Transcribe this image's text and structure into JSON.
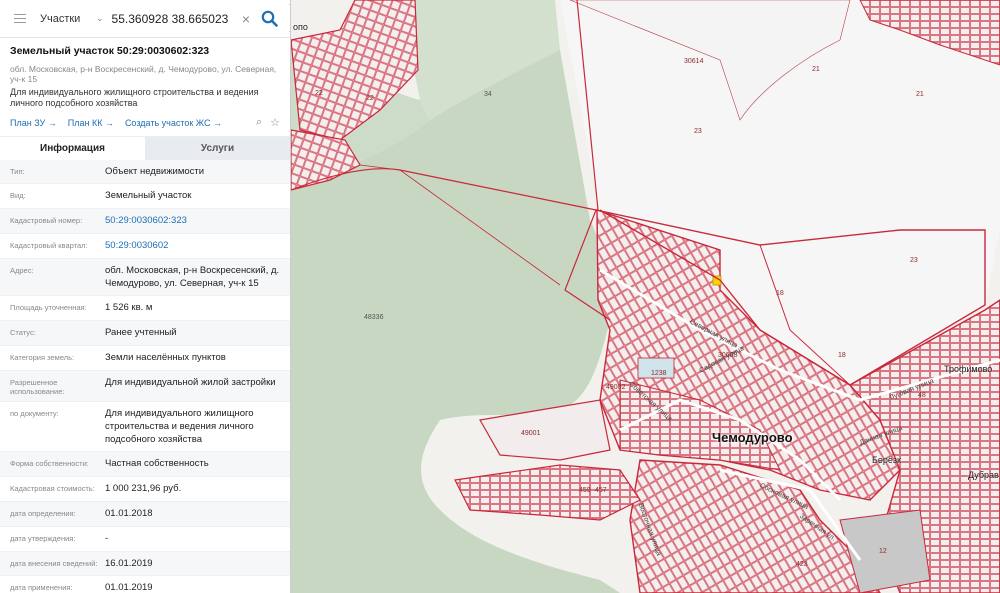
{
  "search": {
    "type": "Участки",
    "query": "55.360928 38.665023"
  },
  "parcel": {
    "title": "Земельный участок 50:29:0030602:323",
    "address": "обл. Московская, р-н Воскресенский, д. Чемодурово, ул. Северная, уч-к 15",
    "purpose": "Для индивидуального жилищного строительства и ведения личного подсобного хозяйства",
    "actions": [
      "План ЗУ →",
      "План КК →",
      "Создать участок ЖС →"
    ]
  },
  "tabs": {
    "info": "Информация",
    "services": "Услуги"
  },
  "info": [
    {
      "label": "Тип:",
      "value": "Объект недвижимости",
      "link": false
    },
    {
      "label": "Вид:",
      "value": "Земельный участок",
      "link": false
    },
    {
      "label": "Кадастровый номер:",
      "value": "50:29:0030602:323",
      "link": true
    },
    {
      "label": "Кадастровый квартал:",
      "value": "50:29:0030602",
      "link": true
    },
    {
      "label": "Адрес:",
      "value": "обл. Московская, р-н Воскресенский, д. Чемодурово, ул. Северная, уч-к 15",
      "link": false
    },
    {
      "label": "Площадь уточненная:",
      "value": "1 526 кв. м",
      "link": false
    },
    {
      "label": "Статус:",
      "value": "Ранее учтенный",
      "link": false
    },
    {
      "label": "Категория земель:",
      "value": "Земли населённых пунктов",
      "link": false
    },
    {
      "label": "Разрешенное использование:",
      "value": "Для индивидуальной жилой застройки",
      "link": false
    },
    {
      "label": "по документу:",
      "value": "Для индивидуального жилищного строительства и ведения личного подсобного хозяйства",
      "link": false
    },
    {
      "label": "Форма собственности:",
      "value": "Частная собственность",
      "link": false
    },
    {
      "label": "Кадастровая стоимость:",
      "value": "1 000 231,96 руб.",
      "link": false
    },
    {
      "label": "дата определения:",
      "value": "01.01.2018",
      "link": false
    },
    {
      "label": "дата утверждения:",
      "value": "-",
      "link": false
    },
    {
      "label": "дата внесения сведений:",
      "value": "16.01.2019",
      "link": false
    },
    {
      "label": "дата применения:",
      "value": "01.01.2019",
      "link": false
    }
  ],
  "map": {
    "village": "Чемодурово",
    "places": [
      "Трофимово",
      "Берёзк",
      "Дубрав",
      "опо"
    ],
    "streets": [
      "Северная улица",
      "Садовая улица",
      "Советская улица",
      "Луговая улица",
      "Сосновая улица",
      "Заречная ул.",
      "Восточная улица",
      "Дачная улица"
    ],
    "parcel_numbers": [
      "22",
      "34",
      "30614",
      "23",
      "21",
      "21",
      "23",
      "18",
      "18",
      "48336",
      "1238",
      "49001",
      "49002",
      "30603",
      "12",
      "423",
      "457",
      "459",
      "22",
      "48"
    ]
  }
}
